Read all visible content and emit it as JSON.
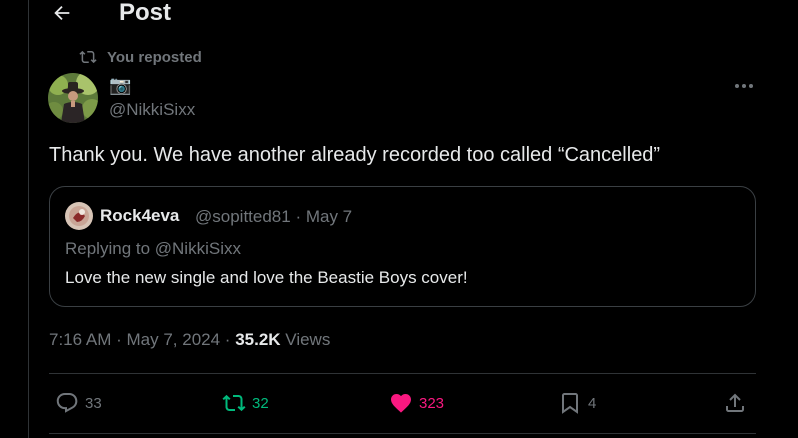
{
  "header": {
    "title": "Post"
  },
  "repost": {
    "label": "You reposted"
  },
  "author": {
    "name": "📷",
    "handle": "@NikkiSixx"
  },
  "post": {
    "text": "Thank you. We have another already recorded too called “Cancelled”",
    "time": "7:16 AM",
    "date": "May 7, 2024",
    "views_count": "35.2K",
    "views_label": "Views"
  },
  "quote": {
    "name": "Rock4eva",
    "handle": "@sopitted81",
    "date": "May 7",
    "replying_to": "Replying to @NikkiSixx",
    "text": "Love the new single and love the Beastie Boys cover!"
  },
  "actions": {
    "replies": "33",
    "reposts": "32",
    "likes": "323",
    "bookmarks": "4"
  },
  "colors": {
    "background": "#000000",
    "text": "#e7e9ea",
    "muted": "#71767b",
    "repost_green": "#00ba7c",
    "like_pink": "#f91880",
    "border": "#2f3336"
  },
  "icons": [
    "back-arrow-icon",
    "repost-icon",
    "more-icon",
    "reply-icon",
    "heart-icon",
    "bookmark-icon",
    "share-icon"
  ]
}
